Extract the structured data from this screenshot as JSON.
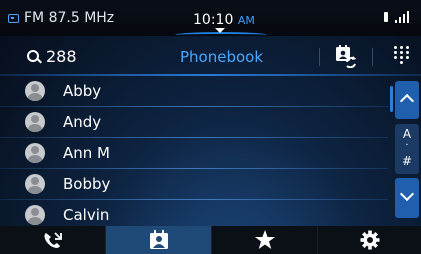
{
  "status_bar": {
    "radio_label": "FM 87.5 MHz",
    "time": "10:10",
    "ampm": "AM"
  },
  "header": {
    "search_value": "288",
    "title": "Phonebook"
  },
  "contacts": [
    {
      "name": "Abby"
    },
    {
      "name": "Andy"
    },
    {
      "name": "Ann M"
    },
    {
      "name": "Bobby"
    },
    {
      "name": "Calvin"
    }
  ],
  "alpha_index": {
    "first": "A",
    "separator": "·",
    "last": "#"
  },
  "bottom_nav": {
    "tabs": [
      {
        "icon": "recent-calls-icon",
        "active": false
      },
      {
        "icon": "contacts-icon",
        "active": true
      },
      {
        "icon": "favorites-star-icon",
        "active": false
      },
      {
        "icon": "settings-gear-icon",
        "active": false
      }
    ]
  },
  "colors": {
    "accent": "#4aa7ff",
    "active_tab": "#1f4a78",
    "scroll_button": "#1f5fae"
  }
}
